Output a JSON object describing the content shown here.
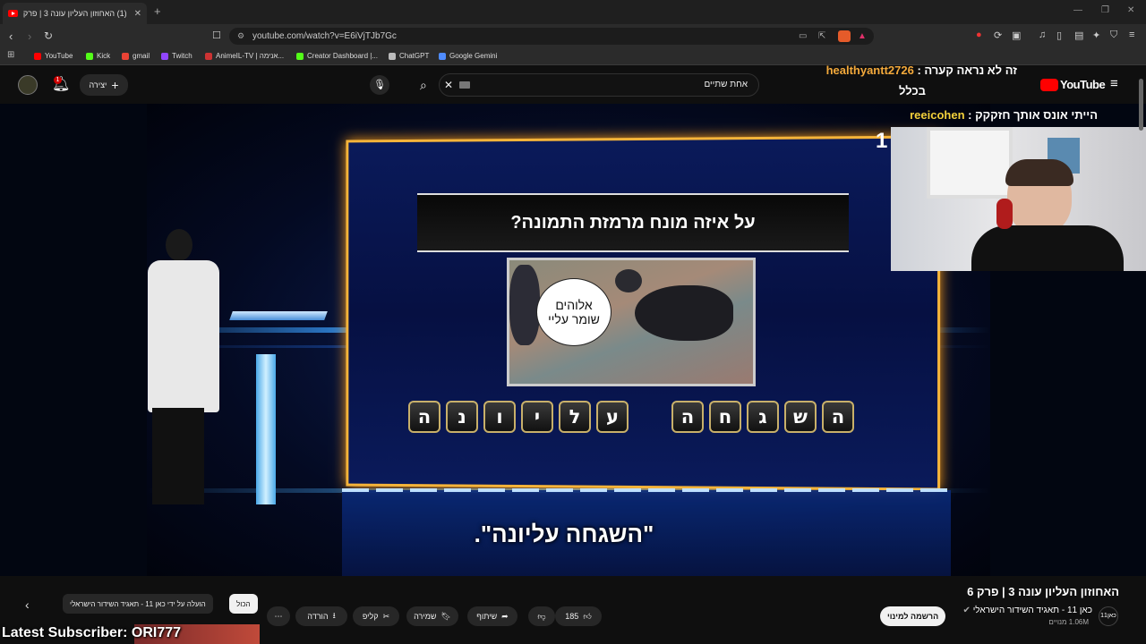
{
  "browser": {
    "tab_title": "(1) האחוזון העליון עונה 3 | פרק 6",
    "url": "youtube.com/watch?v=E6iVjTJb7Gc",
    "bookmarks": [
      {
        "label": "YouTube",
        "color": "#ff0000"
      },
      {
        "label": "Kick",
        "color": "#53fc18"
      },
      {
        "label": "gmail",
        "color": "#ea4335"
      },
      {
        "label": "Twitch",
        "color": "#9146ff"
      },
      {
        "label": "AnimeIL-TV | אנימה...",
        "color": "#cc3333"
      },
      {
        "label": "Creator Dashboard |...",
        "color": "#53fc18"
      },
      {
        "label": "ChatGPT",
        "color": "#bbbbbb"
      },
      {
        "label": "Google Gemini",
        "color": "#4f8cff"
      }
    ]
  },
  "yt_header": {
    "search_value": "אחת שתיים",
    "create_label": "יצירה",
    "notification_count": "1",
    "logo_text": "YouTube"
  },
  "video": {
    "question": "על איזה מונח מרמזת התמונה?",
    "speech_bubble": "אלוהים שומר עליי",
    "answer_word1": [
      "ה",
      "ש",
      "ג",
      "ח",
      "ה"
    ],
    "answer_word2": [
      "ע",
      "ל",
      "י",
      "ו",
      "נ",
      "ה"
    ],
    "subtitle": "\"השגחה עליונה\".",
    "counter": "1"
  },
  "stream_overlay": {
    "chat": [
      {
        "user": "healthyantt2726",
        "message": "זה לא נראה קערה",
        "continuation": "בכלל"
      },
      {
        "user": "reeicohen",
        "message": "הייתי אונס אותך חזקקק"
      }
    ],
    "latest_subscriber": "Latest Subscriber: ORI777"
  },
  "below_video": {
    "title": "האחוזון העליון עונה 3 | פרק 6",
    "channel_name": "כאן 11 - תאגיד השידור הישראלי",
    "subscribers": "1.06M מנויים",
    "subscribe_label": "הרשמה למינוי",
    "likes": "185",
    "share_label": "שיתוף",
    "save_label": "שמירה",
    "clip_label": "קליפ",
    "download_label": "הורדה",
    "chip_all": "הכול",
    "chip_uploader": "הועלה על ידי כאן 11 - תאגיד השידור הישראלי",
    "channel_avatar_text": "כאן11"
  }
}
